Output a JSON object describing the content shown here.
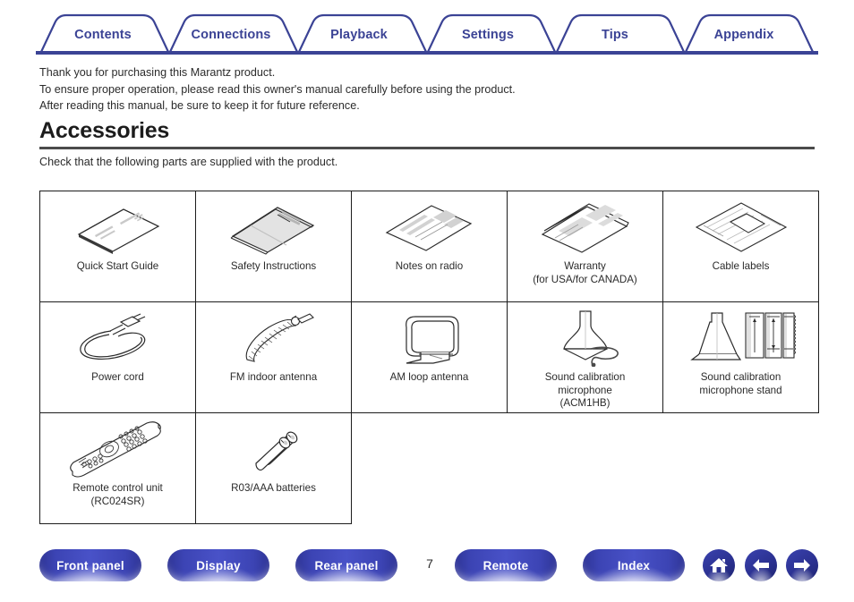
{
  "theme": {
    "tab_color": "#3b4395",
    "rule_color": "#4b4b4b",
    "button_blue": "#3c44b4",
    "text_color": "#2b2b2b"
  },
  "tabs": [
    {
      "label": "Contents"
    },
    {
      "label": "Connections"
    },
    {
      "label": "Playback"
    },
    {
      "label": "Settings"
    },
    {
      "label": "Tips"
    },
    {
      "label": "Appendix"
    }
  ],
  "intro": {
    "line1": "Thank you for purchasing this Marantz product.",
    "line2": "To ensure proper operation, please read this owner's manual carefully before using the product.",
    "line3": "After reading this manual, be sure to keep it for future reference."
  },
  "heading": "Accessories",
  "subtext": "Check that the following parts are supplied with the product.",
  "accessories": [
    [
      {
        "label": "Quick Start Guide",
        "icon": "booklet-plain-icon"
      },
      {
        "label": "Safety Instructions",
        "icon": "booklet-safety-icon"
      },
      {
        "label": "Notes on radio",
        "icon": "sheet-radio-icon"
      },
      {
        "label": "Warranty\n(for USA/for CANADA)",
        "icon": "booklet-warranty-icon"
      },
      {
        "label": "Cable labels",
        "icon": "cable-labels-icon"
      }
    ],
    [
      {
        "label": "Power cord",
        "icon": "power-cord-icon"
      },
      {
        "label": "FM indoor antenna",
        "icon": "fm-antenna-icon"
      },
      {
        "label": "AM loop antenna",
        "icon": "am-loop-antenna-icon"
      },
      {
        "label": "Sound calibration\nmicrophone\n(ACM1HB)",
        "icon": "calibration-mic-icon"
      },
      {
        "label": "Sound calibration\nmicrophone stand",
        "icon": "mic-stand-icon"
      }
    ],
    [
      {
        "label": "Remote control unit\n(RC024SR)",
        "icon": "remote-control-icon"
      },
      {
        "label": "R03/AAA batteries",
        "icon": "batteries-icon"
      }
    ]
  ],
  "footer": {
    "buttons": [
      {
        "label": "Front panel"
      },
      {
        "label": "Display"
      },
      {
        "label": "Rear panel"
      },
      {
        "label": "Remote"
      },
      {
        "label": "Index"
      }
    ],
    "page_number": "7",
    "icons": [
      {
        "name": "home-icon"
      },
      {
        "name": "arrow-left-icon"
      },
      {
        "name": "arrow-right-icon"
      }
    ]
  }
}
